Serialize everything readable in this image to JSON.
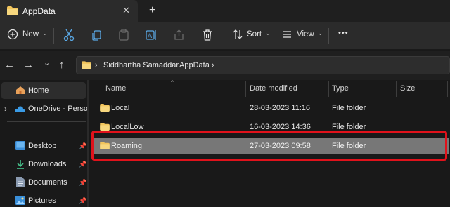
{
  "window": {
    "tab_title": "AppData",
    "close_glyph": "✕",
    "new_tab_glyph": "+"
  },
  "toolbar": {
    "new_label": "New",
    "sort_label": "Sort",
    "view_label": "View",
    "more_glyph": "•••",
    "chevron_glyph": "⌄"
  },
  "navigation": {
    "back_glyph": "←",
    "forward_glyph": "→",
    "recent_glyph": "⌄",
    "up_glyph": "↑"
  },
  "address": {
    "separator": "›",
    "crumbs": [
      "Siddhartha Samaddar",
      "AppData"
    ]
  },
  "sidebar": {
    "expand_glyph": "›",
    "pin_glyph": "📌",
    "items": [
      {
        "label": "Home",
        "icon": "home-icon"
      },
      {
        "label": "OneDrive - Persona",
        "icon": "cloud-icon"
      },
      {
        "label": "Desktop",
        "icon": "desktop-icon",
        "pinned": true
      },
      {
        "label": "Downloads",
        "icon": "download-icon",
        "pinned": true
      },
      {
        "label": "Documents",
        "icon": "document-icon",
        "pinned": true
      },
      {
        "label": "Pictures",
        "icon": "picture-icon",
        "pinned": true
      }
    ]
  },
  "file_list": {
    "columns": [
      "Name",
      "Date modified",
      "Type",
      "Size"
    ],
    "sort_glyph": "^",
    "rows": [
      {
        "name": "Local",
        "date": "28-03-2023 11:16",
        "type": "File folder",
        "size": ""
      },
      {
        "name": "LocalLow",
        "date": "16-03-2023 14:36",
        "type": "File folder",
        "size": ""
      },
      {
        "name": "Roaming",
        "date": "27-03-2023 09:58",
        "type": "File folder",
        "size": "",
        "selected": true
      }
    ]
  },
  "colors": {
    "folder": "#f2c55c",
    "highlight": "#e0121b",
    "selection": "#777777",
    "accent": "#4cc2ff"
  }
}
